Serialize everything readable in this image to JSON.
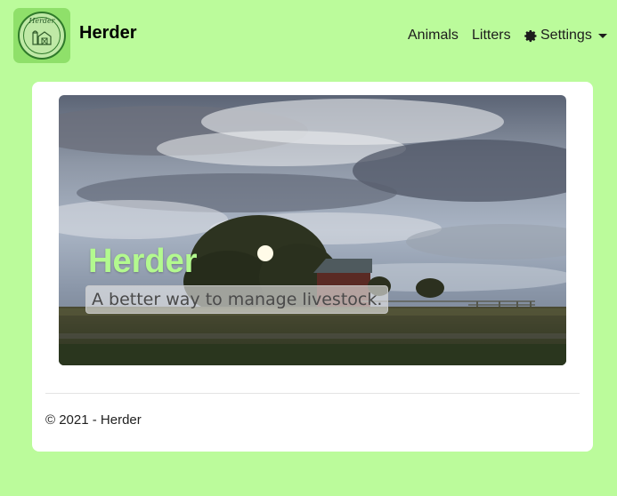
{
  "navbar": {
    "logo_text": "Herder",
    "brand": "Herder",
    "links": [
      {
        "label": "Animals"
      },
      {
        "label": "Litters"
      }
    ],
    "settings_label": "Settings"
  },
  "hero": {
    "title": "Herder",
    "tagline": "A better way to manage livestock."
  },
  "footer": {
    "text": "© 2021 - Herder"
  },
  "colors": {
    "background": "#bbfb9b",
    "hero_title": "#b3f98f",
    "card": "#ffffff"
  }
}
